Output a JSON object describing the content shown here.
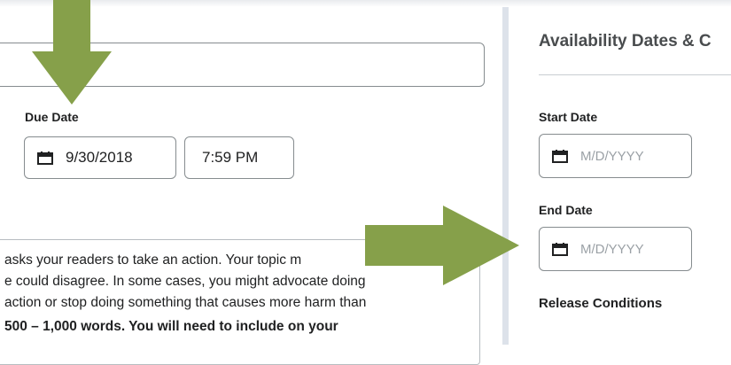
{
  "due": {
    "label": "Due Date",
    "date_value": "9/30/2018",
    "time_value": "7:59 PM"
  },
  "description": {
    "lines": [
      "asks your readers to take an action. Your topic m",
      "e could disagree. In some cases, you might advocate doing",
      "action or stop doing something that causes more harm than",
      "500 – 1,000 words. You will need to include on your"
    ]
  },
  "availability": {
    "title": "Availability Dates & C",
    "start_label": "Start Date",
    "start_placeholder": "M/D/YYYY",
    "end_label": "End Date",
    "end_placeholder": "M/D/YYYY",
    "release_label": "Release Conditions"
  },
  "colors": {
    "arrow": "#86a04a",
    "border": "#868c8f",
    "divider": "#dde2ea"
  },
  "icons": [
    "calendar-icon",
    "down-arrow-annotation",
    "right-arrow-annotation"
  ]
}
